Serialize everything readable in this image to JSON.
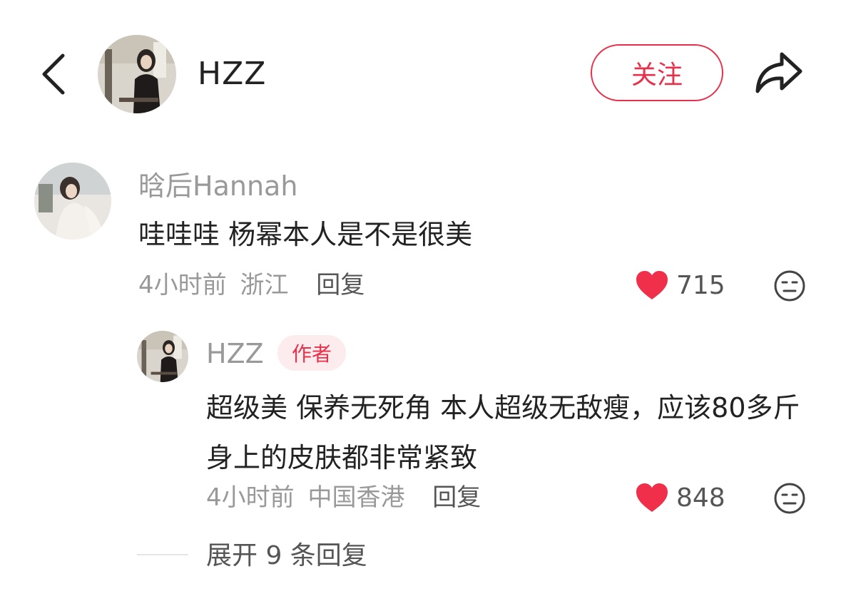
{
  "header": {
    "author_name": "HZZ",
    "follow_label": "关注"
  },
  "comment": {
    "user_name": "晗后Hannah",
    "text": "哇哇哇 杨幂本人是不是很美",
    "time": "4小时前",
    "location": "浙江",
    "reply_label": "回复",
    "likes": "715"
  },
  "reply": {
    "user_name": "HZZ",
    "badge": "作者",
    "text": "超级美 保养无死角 本人超级无敌瘦，应该80多斤 身上的皮肤都非常紧致",
    "time": "4小时前",
    "location": "中国香港",
    "reply_label": "回复",
    "likes": "848"
  },
  "expand_label": "展开 9 条回复",
  "colors": {
    "accent": "#e8304a",
    "like_heart": "#f0304a",
    "meta_text": "#999999"
  },
  "icons": [
    "back-arrow-icon",
    "share-icon",
    "heart-icon",
    "emoji-face-icon"
  ]
}
